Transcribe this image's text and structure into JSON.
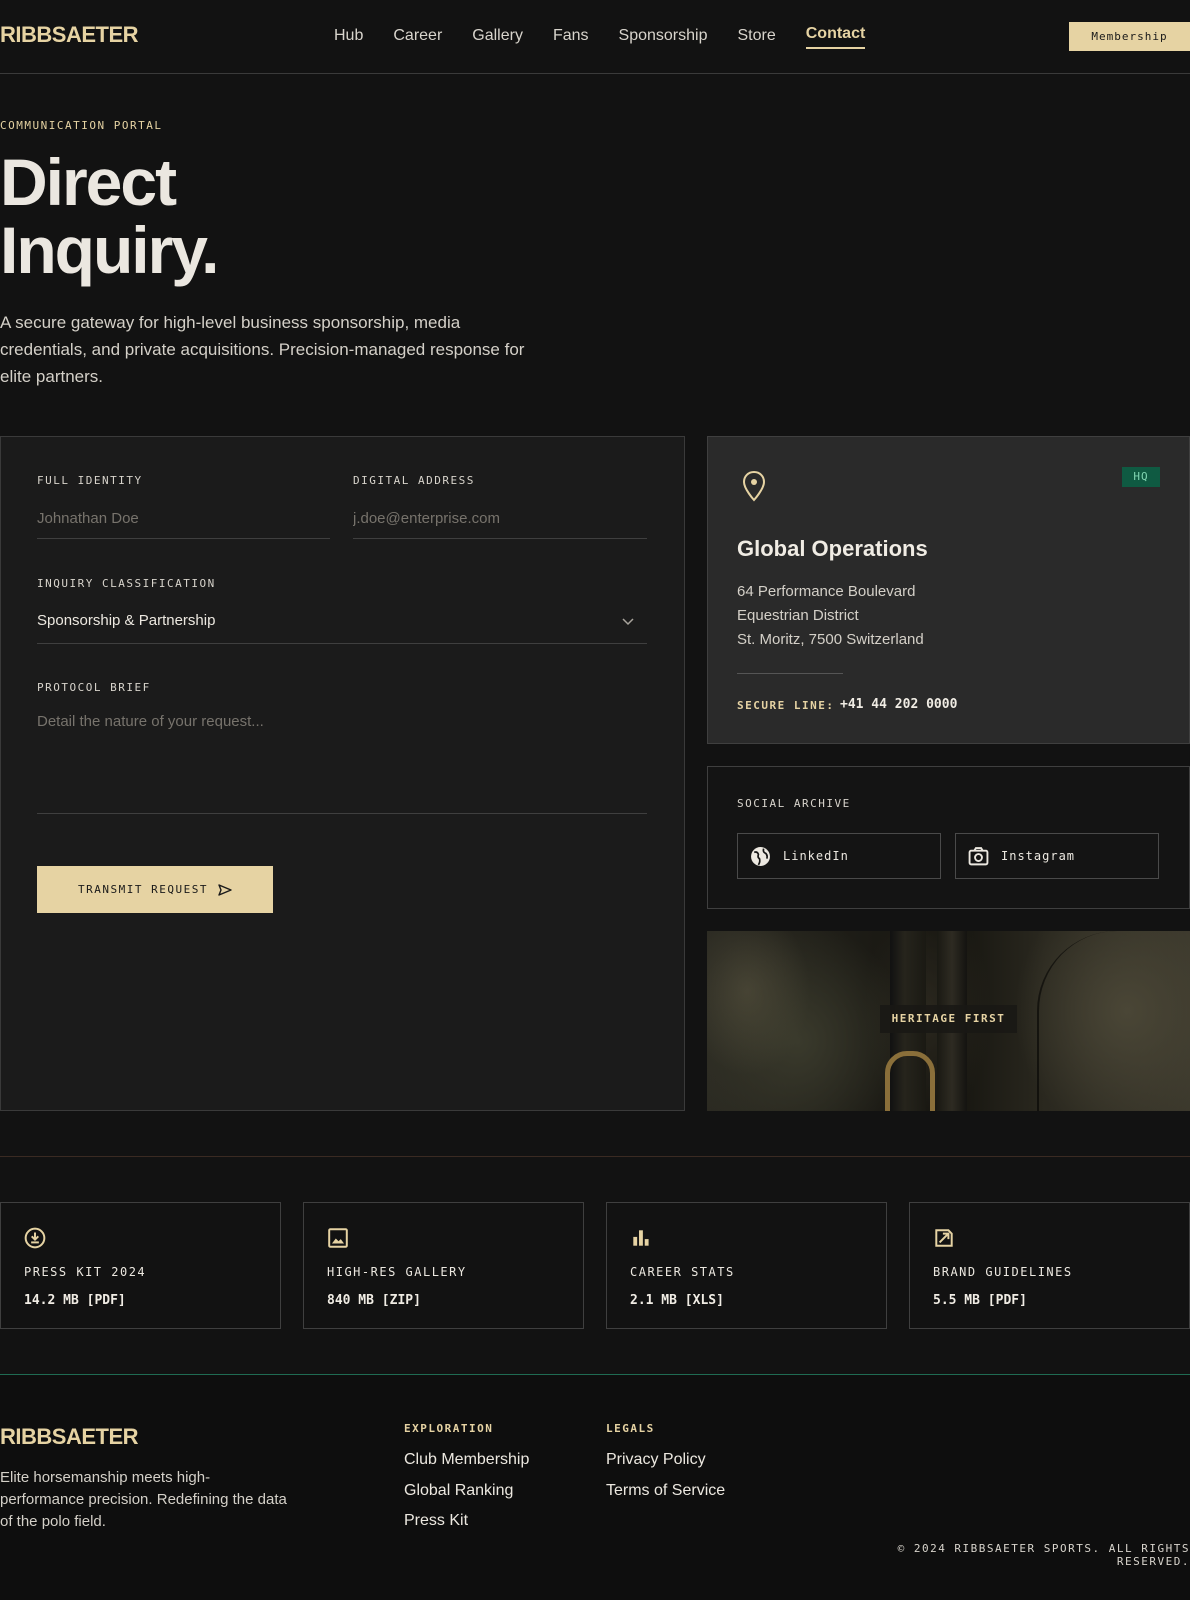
{
  "nav": {
    "brand": "RIBBSAETER",
    "links": [
      "Hub",
      "Career",
      "Gallery",
      "Fans",
      "Sponsorship",
      "Store",
      "Contact"
    ],
    "active": "Contact",
    "membership_label": "Membership"
  },
  "hero": {
    "eyebrow": "COMMUNICATION PORTAL",
    "title_line1": "Direct",
    "title_line2": "Inquiry.",
    "subtitle": "A secure gateway for high-level business sponsorship, media credentials, and private acquisitions. Precision-managed response for elite partners."
  },
  "form": {
    "name_label": "FULL IDENTITY",
    "name_placeholder": "Johnathan Doe",
    "email_label": "DIGITAL ADDRESS",
    "email_placeholder": "j.doe@enterprise.com",
    "class_label": "INQUIRY CLASSIFICATION",
    "class_value": "Sponsorship & Partnership",
    "brief_label": "PROTOCOL BRIEF",
    "brief_placeholder": "Detail the nature of your request...",
    "submit_label": "TRANSMIT REQUEST"
  },
  "hq": {
    "badge": "HQ",
    "title": "Global Operations",
    "address_line1": "64 Performance Boulevard",
    "address_line2": "Equestrian District",
    "address_line3": "St. Moritz, 7500 Switzerland",
    "secure_label": "SECURE LINE:",
    "secure_value": "+41 44 202 0000"
  },
  "social": {
    "label": "SOCIAL ARCHIVE",
    "linkedin": "LinkedIn",
    "instagram": "Instagram"
  },
  "heritage": {
    "tag": "HERITAGE FIRST"
  },
  "downloads": [
    {
      "title": "PRESS KIT 2024",
      "size": "14.2 MB [PDF]",
      "icon": "download-icon"
    },
    {
      "title": "HIGH-RES GALLERY",
      "size": "840 MB [ZIP]",
      "icon": "image-icon"
    },
    {
      "title": "CAREER STATS",
      "size": "2.1 MB [XLS]",
      "icon": "bar-chart-icon"
    },
    {
      "title": "BRAND GUIDELINES",
      "size": "5.5 MB [PDF]",
      "icon": "brand-icon"
    }
  ],
  "footer": {
    "brand": "RIBBSAETER",
    "tagline": "Elite horsemanship meets high-performance precision. Redefining the data of the polo field.",
    "exploration_head": "EXPLORATION",
    "exploration_links": [
      "Club Membership",
      "Global Ranking",
      "Press Kit"
    ],
    "legals_head": "LEGALS",
    "legals_links": [
      "Privacy Policy",
      "Terms of Service"
    ],
    "copyright": "© 2024 RIBBSAETER SPORTS. ALL RIGHTS RESERVED."
  },
  "colors": {
    "accent": "#e6d3a3",
    "badge_bg": "#0f5a42",
    "footer_border": "#1f6b52",
    "background": "#121212"
  }
}
